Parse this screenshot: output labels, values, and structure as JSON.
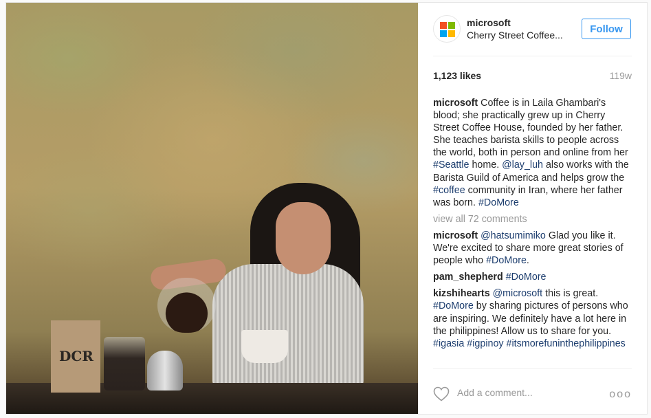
{
  "post": {
    "brand_colors": {
      "red": "#f25022",
      "green": "#7fba00",
      "blue": "#00a4ef",
      "yellow": "#ffb900"
    },
    "accent_color": "#3897f0",
    "photo": {
      "bag_label": "DCR"
    },
    "header": {
      "username": "microsoft",
      "location": "Cherry Street Coffee...",
      "follow_label": "Follow"
    },
    "likes": "1,123 likes",
    "age": "119w",
    "caption": {
      "user": "microsoft",
      "t1": " Coffee is in Laila Ghambari's blood; she practically grew up in Cherry Street Coffee House, founded by her father. She teaches barista skills to people across the world, both in person and online from her ",
      "tag1": "#Seattle",
      "t2": " home. ",
      "tag2": "@lay_luh",
      "t3": " also works with the Barista Guild of America and helps grow the ",
      "tag3": "#coffee",
      "t4": " community in Iran, where her father was born. ",
      "tag4": "#DoMore"
    },
    "view_all": "view all 72 comments",
    "comments": [
      {
        "user": "microsoft",
        "pre": " ",
        "tag": "@hatsumimiko",
        "text": " Glad you like it. We're excited to share more great stories of people who ",
        "tag2": "#DoMore",
        "text2": "."
      },
      {
        "user": "pam_shepherd",
        "pre": " ",
        "tag": "#DoMore"
      },
      {
        "user": "kizshihearts",
        "pre": " ",
        "tag": "@microsoft",
        "text": " this is great. ",
        "tag2": "#DoMore",
        "text2": " by sharing pictures of persons who are inspiring. We definitely have a lot here in the philippines! Allow us to share for you. ",
        "tag3": "#igasia",
        "text3": " ",
        "tag4": "#igpinoy",
        "text4": " ",
        "tag5": "#itsmorefuninthephilippines"
      }
    ],
    "footer": {
      "placeholder": "Add a comment...",
      "more": "ooo"
    }
  }
}
